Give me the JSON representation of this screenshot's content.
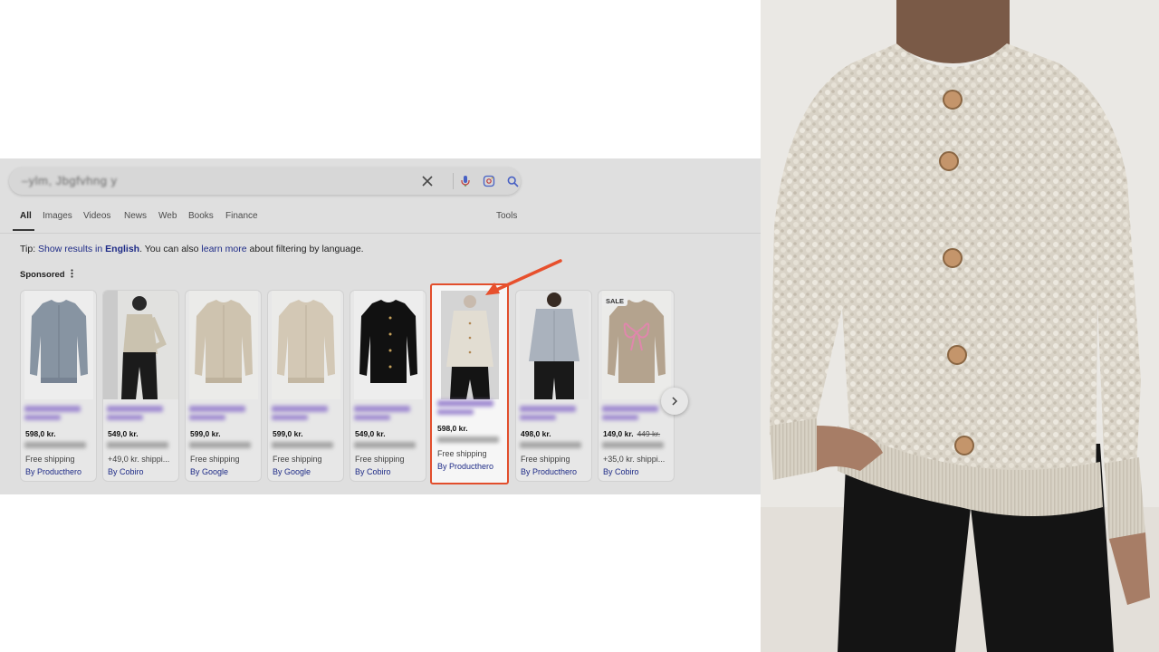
{
  "search": {
    "query": "–ylm, Jbgfvhng y"
  },
  "tabs": [
    "All",
    "Images",
    "Videos",
    "News",
    "Web",
    "Books",
    "Finance"
  ],
  "tools_label": "Tools",
  "tip": {
    "prefix": "Tip: ",
    "link1": "Show results in ",
    "link1_bold": "English",
    "middle": ". You can also ",
    "link2": "learn more",
    "suffix": " about filtering by language."
  },
  "sponsored_label": "Sponsored",
  "products": [
    {
      "price": "598,0 kr.",
      "shipping": "Free shipping",
      "by": "By Producthero"
    },
    {
      "price": "549,0 kr.",
      "shipping": "+49,0 kr. shippi...",
      "by": "By Cobiro"
    },
    {
      "price": "599,0 kr.",
      "shipping": "Free shipping",
      "by": "By Google"
    },
    {
      "price": "599,0 kr.",
      "shipping": "Free shipping",
      "by": "By Google"
    },
    {
      "price": "549,0 kr.",
      "shipping": "Free shipping",
      "by": "By Cobiro"
    },
    {
      "price": "598,0 kr.",
      "shipping": "Free shipping",
      "by": "By Producthero"
    },
    {
      "price": "498,0 kr.",
      "shipping": "Free shipping",
      "by": "By Producthero"
    },
    {
      "price": "149,0 kr.",
      "old_price": "449 kr.",
      "shipping": "+35,0 kr. shippi...",
      "by": "By Cobiro",
      "badge": "SALE"
    }
  ],
  "colors": {
    "highlight": "#e7502d",
    "link": "#1f2c8a"
  }
}
